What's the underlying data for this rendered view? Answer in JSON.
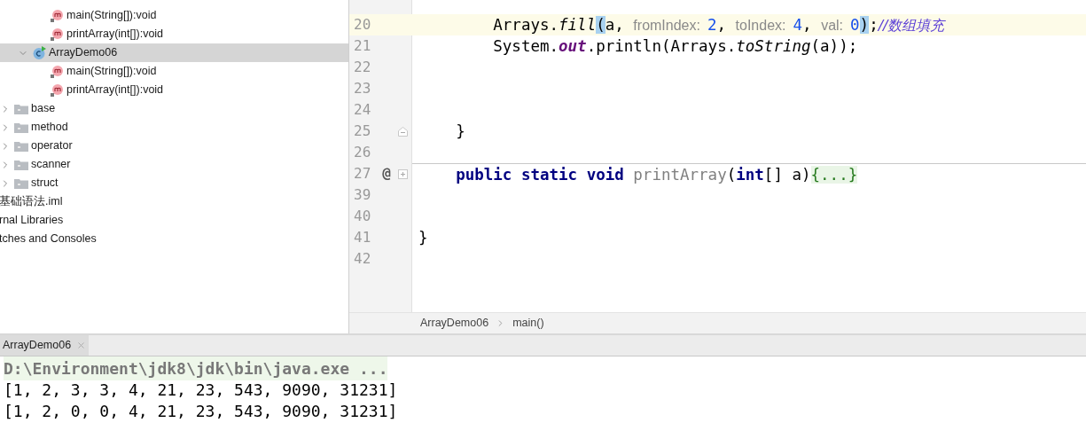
{
  "project_tree": [
    {
      "children": [
        {
          "children": [
            {
              "children": [
                {
                  "label": "main(String[]):void",
                  "kind": "method",
                  "selected": false
                },
                {
                  "label": "printArray(int[]):void",
                  "kind": "method",
                  "selected": false
                }
              ]
            },
            {
              "label": "ArrayDemo06",
              "kind": "class",
              "selected": true,
              "expanded": true,
              "children": [
                {
                  "label": "main(String[]):void",
                  "kind": "method",
                  "selected": false
                },
                {
                  "label": "printArray(int[]):void",
                  "kind": "method",
                  "selected": false
                }
              ]
            }
          ]
        },
        {
          "label": "base",
          "kind": "folder",
          "selected": false,
          "expanded": false
        },
        {
          "label": "method",
          "kind": "folder",
          "selected": false,
          "expanded": false
        },
        {
          "label": "operator",
          "kind": "folder",
          "selected": false,
          "expanded": false
        },
        {
          "label": "scanner",
          "kind": "folder",
          "selected": false,
          "expanded": false
        },
        {
          "label": "struct",
          "kind": "folder",
          "selected": false,
          "expanded": false
        }
      ]
    },
    {
      "label": "基础语法.iml",
      "kind": "file",
      "selected": false
    },
    {
      "label": "rnal Libraries",
      "kind": "file",
      "selected": false
    },
    {
      "label": "tches and Consoles",
      "kind": "file",
      "selected": false
    }
  ],
  "editor": {
    "lines": [
      {
        "number": "20",
        "current": true,
        "tokens": [
          {
            "text": "        Arrays.",
            "kind": "plain"
          },
          {
            "text": "fill",
            "kind": "static"
          },
          {
            "text": "(",
            "kind": "brace"
          },
          {
            "text": "a, ",
            "kind": "plain"
          },
          {
            "text": "fromIndex:",
            "kind": "hint"
          },
          {
            "text": "2",
            "kind": "number"
          },
          {
            "text": ", ",
            "kind": "plain"
          },
          {
            "text": "toIndex:",
            "kind": "hint"
          },
          {
            "text": "4",
            "kind": "number"
          },
          {
            "text": ", ",
            "kind": "plain"
          },
          {
            "text": "val:",
            "kind": "hint"
          },
          {
            "text": "0",
            "kind": "number"
          },
          {
            "text": ")",
            "kind": "brace"
          },
          {
            "text": ";",
            "kind": "plain"
          },
          {
            "text": "//数组填充",
            "kind": "comment"
          }
        ]
      },
      {
        "number": "21",
        "current": false,
        "tokens": [
          {
            "text": "        System.",
            "kind": "plain"
          },
          {
            "text": "out",
            "kind": "field"
          },
          {
            "text": ".println(Arrays.",
            "kind": "plain"
          },
          {
            "text": "toString",
            "kind": "static"
          },
          {
            "text": "(a));",
            "kind": "plain"
          }
        ]
      },
      {
        "number": "22",
        "current": false
      },
      {
        "number": "23",
        "current": false
      },
      {
        "number": "24",
        "current": false
      },
      {
        "number": "25",
        "current": false,
        "fold_expanded": true,
        "tokens": [
          {
            "text": "    }",
            "kind": "plain"
          }
        ]
      },
      {
        "number": "26",
        "current": false
      },
      {
        "number": "27",
        "current": false,
        "separator": true,
        "marker": "@",
        "fold_expanded": false,
        "tokens": [
          {
            "text": "    public static void ",
            "kind": "keyword"
          },
          {
            "text": "printArray",
            "kind": "unused"
          },
          {
            "text": "(",
            "kind": "plain"
          },
          {
            "text": "int",
            "kind": "keyword"
          },
          {
            "text": "[] a)",
            "kind": "plain"
          },
          {
            "text": "{...}",
            "kind": "folded"
          }
        ]
      },
      {
        "number": "39",
        "current": false
      },
      {
        "number": "40",
        "current": false
      },
      {
        "number": "41",
        "current": false,
        "tokens": [
          {
            "text": "}",
            "kind": "plain"
          }
        ]
      },
      {
        "number": "42",
        "current": false
      }
    ],
    "breadcrumb": [
      "ArrayDemo06",
      "main()"
    ]
  },
  "run_panel": {
    "tab": {
      "label": "ArrayDemo06",
      "selected": true
    },
    "output": [
      {
        "text": "D:\\Environment\\jdk8\\jdk\\bin\\java.exe ...",
        "kind": "command"
      },
      {
        "text": "[1, 2, 3, 3, 4, 21, 23, 543, 9090, 31231]",
        "kind": "stdout"
      },
      {
        "text": "[1, 2, 0, 0, 4, 21, 23, 543, 9090, 31231]",
        "kind": "stdout"
      }
    ]
  }
}
